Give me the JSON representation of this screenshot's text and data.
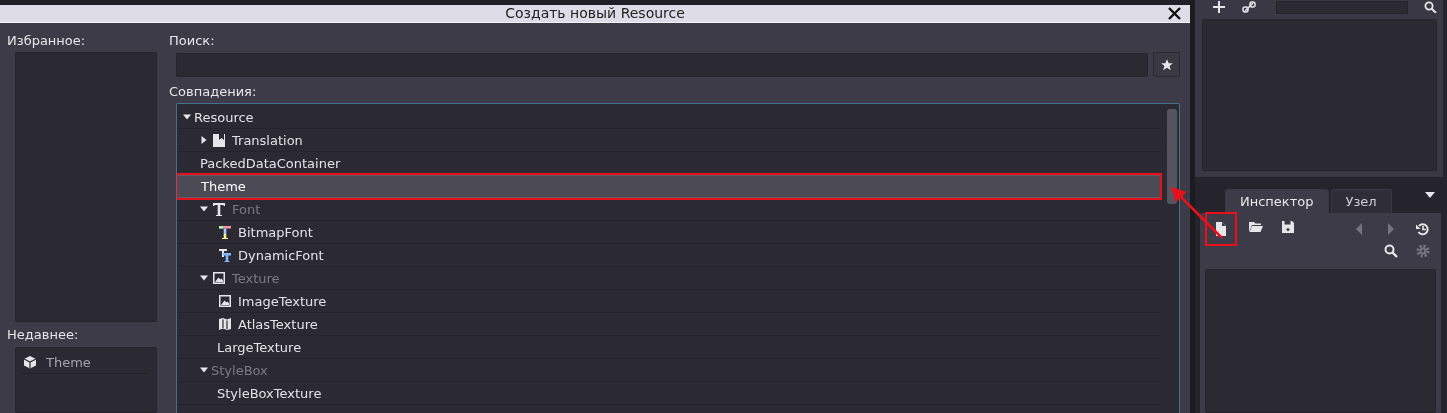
{
  "dialog": {
    "title": "Создать новый Resource",
    "favorites": {
      "label": "Избранное:"
    },
    "recent": {
      "label": "Недавнее:",
      "items": [
        {
          "label": "Theme",
          "kind": "cube",
          "selected": false
        }
      ]
    },
    "search": {
      "label": "Поиск:"
    },
    "matches": {
      "label": "Совпадения:",
      "tree": [
        {
          "label": "Resource",
          "expanded": true,
          "disabled": false,
          "selected": false,
          "outlined": false,
          "children": [
            {
              "label": "Translation",
              "kind": "document",
              "expanded": false,
              "disabled": false,
              "selected": false,
              "outlined": false
            },
            {
              "label": "PackedDataContainer",
              "disabled": false,
              "selected": false,
              "outlined": false
            },
            {
              "label": "Theme",
              "disabled": false,
              "selected": true,
              "outlined": true
            },
            {
              "label": "Font",
              "kind": "font",
              "expanded": true,
              "disabled": true,
              "selected": false,
              "outlined": false,
              "children": [
                {
                  "label": "BitmapFont",
                  "kind": "font-color",
                  "disabled": false,
                  "selected": false,
                  "outlined": false
                },
                {
                  "label": "DynamicFont",
                  "kind": "font-dynamic",
                  "disabled": false,
                  "selected": false,
                  "outlined": false
                }
              ]
            },
            {
              "label": "Texture",
              "kind": "image",
              "expanded": true,
              "disabled": true,
              "selected": false,
              "outlined": false,
              "children": [
                {
                  "label": "ImageTexture",
                  "kind": "image",
                  "disabled": false,
                  "selected": false,
                  "outlined": false
                },
                {
                  "label": "AtlasTexture",
                  "kind": "map",
                  "disabled": false,
                  "selected": false,
                  "outlined": false
                },
                {
                  "label": "LargeTexture",
                  "disabled": false,
                  "selected": false,
                  "outlined": false
                }
              ]
            },
            {
              "label": "StyleBox",
              "expanded": true,
              "disabled": true,
              "selected": false,
              "outlined": false,
              "children": [
                {
                  "label": "StyleBoxTexture",
                  "disabled": false,
                  "selected": false,
                  "outlined": false
                }
              ]
            }
          ]
        }
      ]
    }
  },
  "side_panel": {
    "tabs": [
      {
        "label": "Инспектор",
        "selected": true
      },
      {
        "label": "Узел",
        "selected": false
      }
    ],
    "tool_rows": [
      {
        "left": [
          {
            "kind": "new",
            "disabled": false,
            "outlined": true
          },
          {
            "kind": "open",
            "disabled": false,
            "outlined": false
          },
          {
            "kind": "save",
            "disabled": false,
            "outlined": false
          }
        ],
        "right": [
          {
            "kind": "back",
            "disabled": true,
            "outlined": false
          },
          {
            "kind": "forward",
            "disabled": true,
            "outlined": false
          },
          {
            "kind": "history",
            "disabled": false,
            "outlined": false
          }
        ]
      },
      {
        "left": [],
        "right": [
          {
            "kind": "search",
            "disabled": false,
            "outlined": false
          },
          {
            "kind": "gear",
            "disabled": true,
            "outlined": false
          }
        ]
      }
    ]
  }
}
